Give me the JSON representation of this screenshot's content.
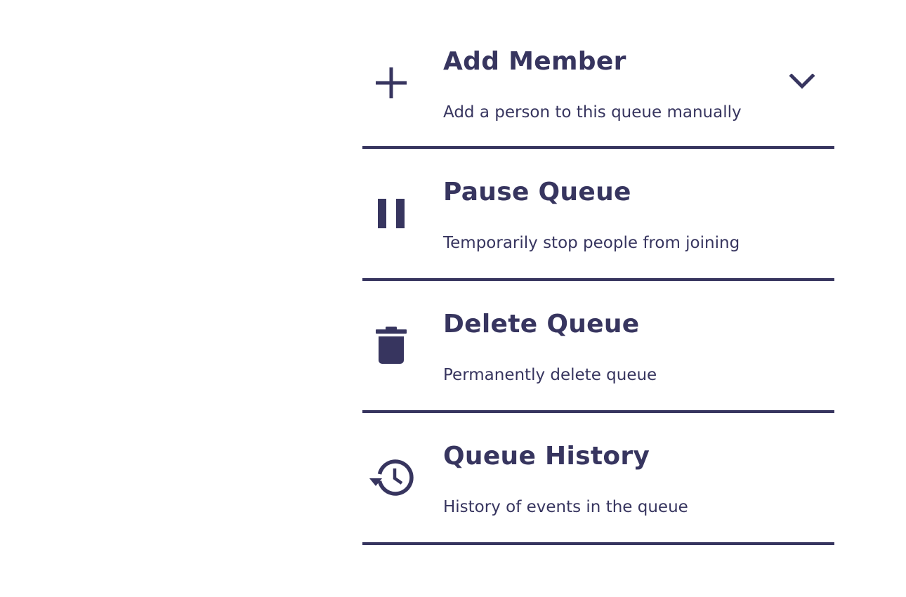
{
  "colors": {
    "accent": "#37355f",
    "background": "#ffffff"
  },
  "menu": {
    "items": [
      {
        "icon": "plus-icon",
        "title": "Add Member",
        "description": "Add a person to this queue manually",
        "expand_icon": "chevron-down-icon"
      },
      {
        "icon": "pause-icon",
        "title": "Pause Queue",
        "description": "Temporarily stop people from joining"
      },
      {
        "icon": "trash-icon",
        "title": "Delete Queue",
        "description": "Permanently delete queue"
      },
      {
        "icon": "history-icon",
        "title": "Queue History",
        "description": "History of events in the queue"
      }
    ]
  }
}
